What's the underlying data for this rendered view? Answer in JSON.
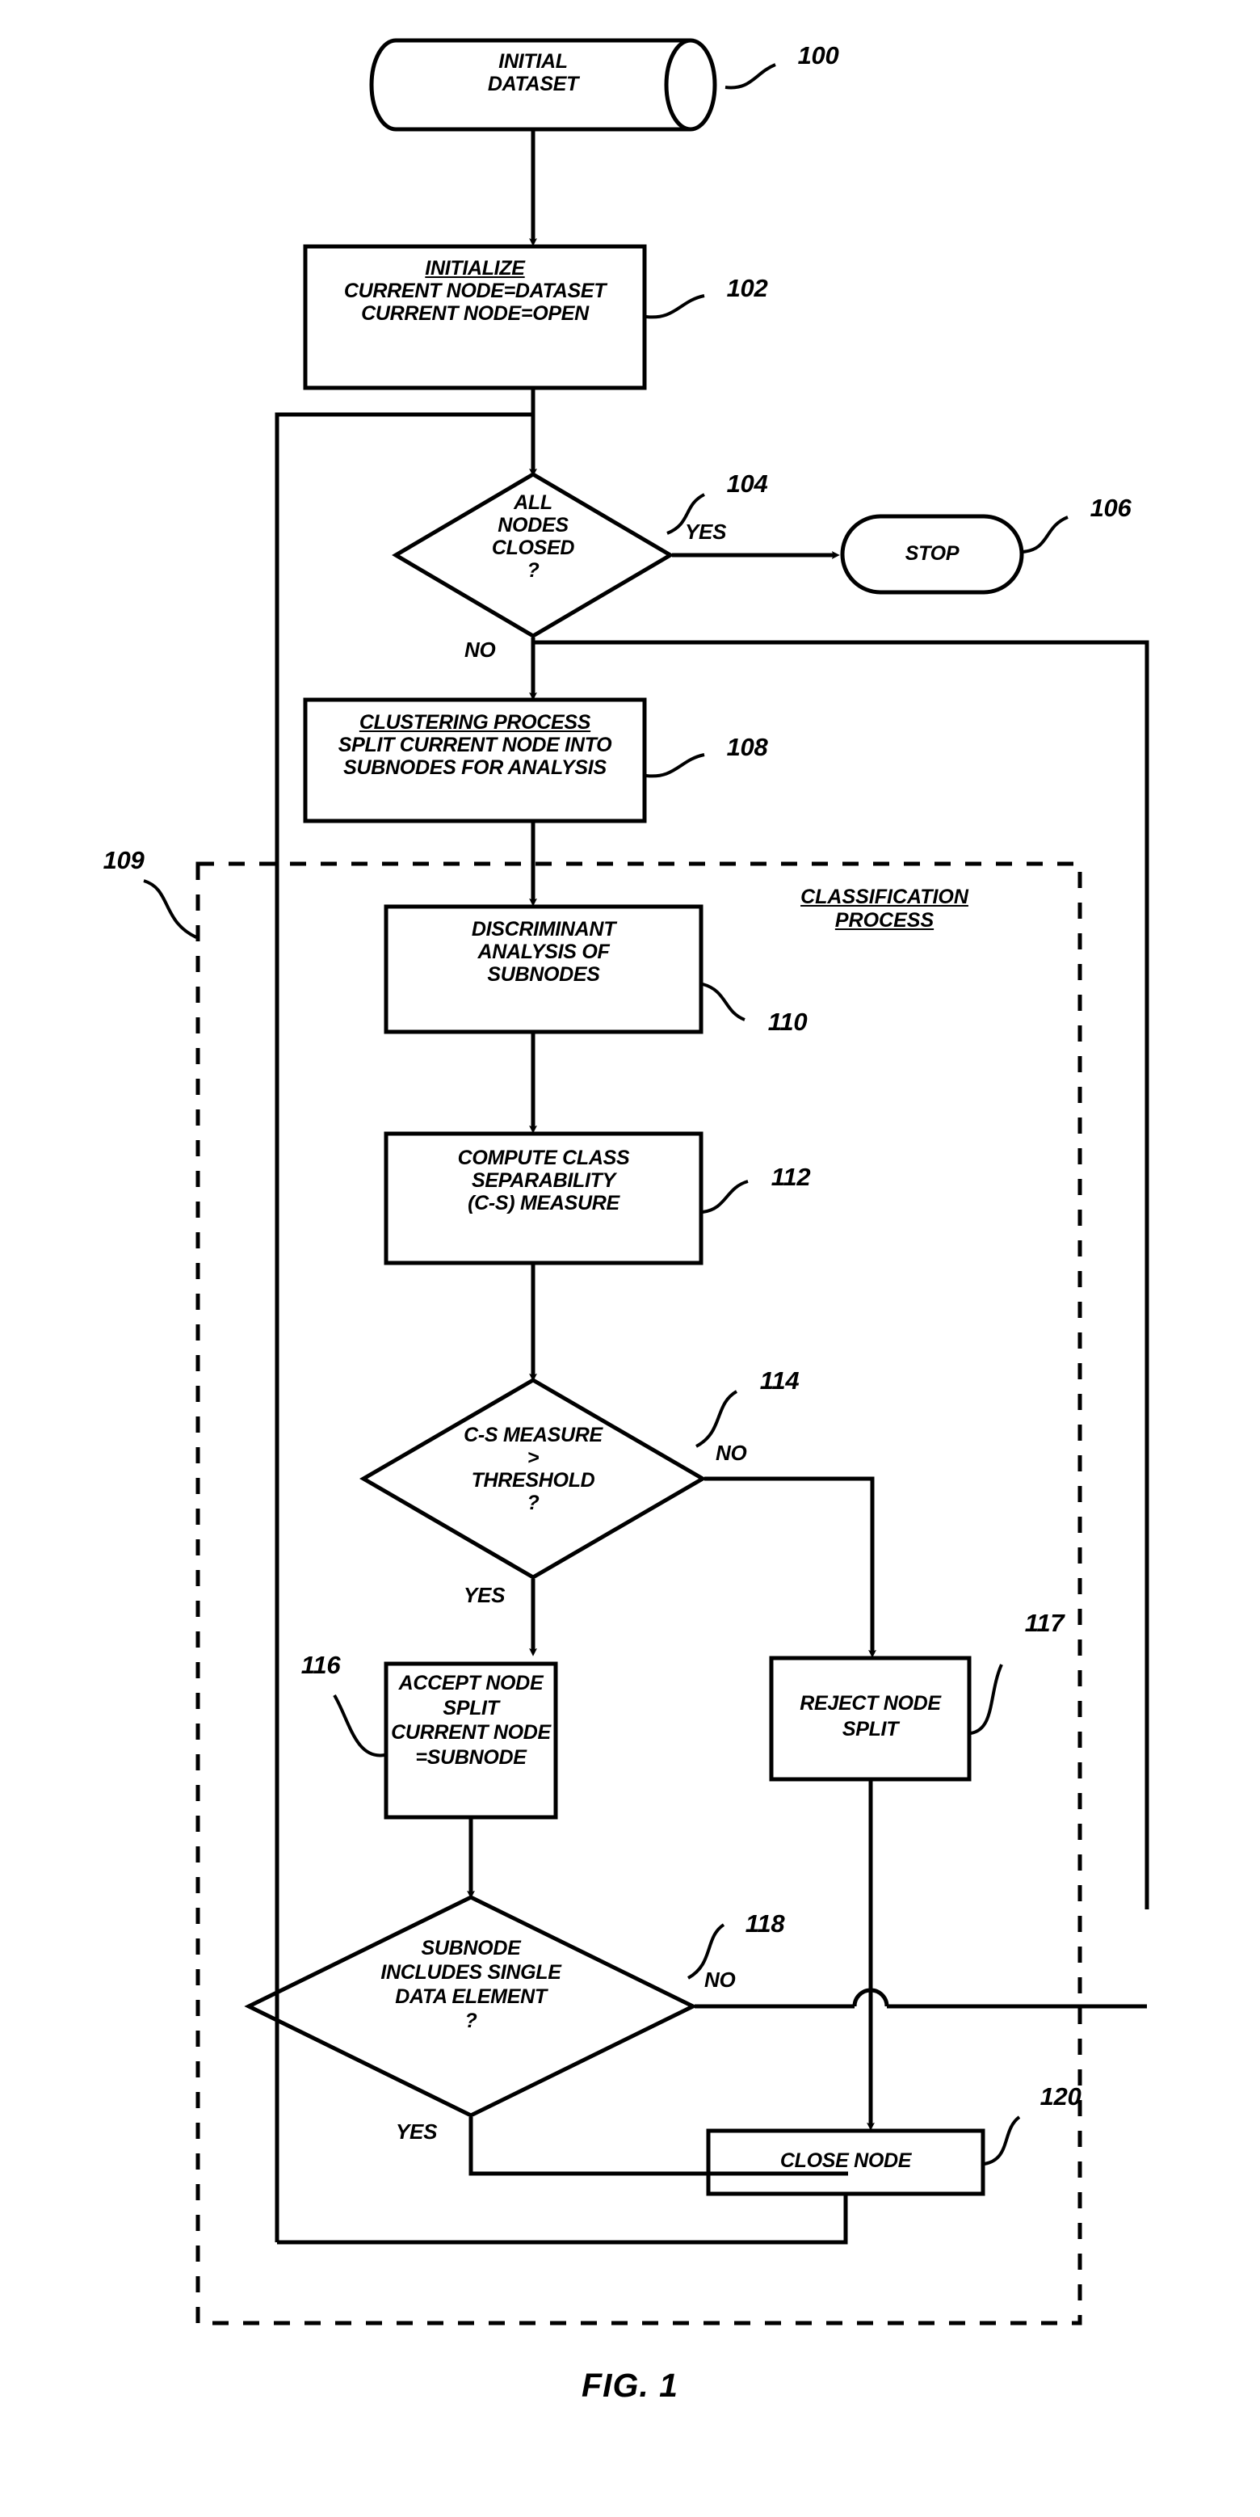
{
  "figure": {
    "caption": "FIG. 1",
    "title": "Flowchart of clustering and classification process"
  },
  "nodes": [
    {
      "id": "100",
      "ref": "100",
      "shape": "cylinder",
      "lines": [
        "INITIAL",
        "DATASET"
      ],
      "underline": []
    },
    {
      "id": "102",
      "ref": "102",
      "shape": "process",
      "lines": [
        "INITIALIZE",
        "CURRENT NODE=DATASET",
        "CURRENT NODE=OPEN"
      ],
      "underline": [
        0
      ]
    },
    {
      "id": "104",
      "ref": "104",
      "shape": "decision",
      "lines": [
        "ALL",
        "NODES",
        "CLOSED",
        "?"
      ],
      "underline": []
    },
    {
      "id": "106",
      "ref": "106",
      "shape": "terminator",
      "lines": [
        "STOP"
      ],
      "underline": []
    },
    {
      "id": "108",
      "ref": "108",
      "shape": "process",
      "lines": [
        "CLUSTERING PROCESS",
        "SPLIT CURRENT NODE INTO",
        "SUBNODES FOR ANALYSIS"
      ],
      "underline": [
        0
      ]
    },
    {
      "id": "110",
      "ref": "110",
      "shape": "process",
      "lines": [
        "DISCRIMINANT",
        "ANALYSIS OF",
        "SUBNODES"
      ],
      "underline": []
    },
    {
      "id": "112",
      "ref": "112",
      "shape": "process",
      "lines": [
        "COMPUTE CLASS",
        "SEPARABILITY",
        "(C-S) MEASURE"
      ],
      "underline": []
    },
    {
      "id": "114",
      "ref": "114",
      "shape": "decision",
      "lines": [
        "C-S MEASURE",
        ">",
        "THRESHOLD",
        "?"
      ],
      "underline": []
    },
    {
      "id": "116",
      "ref": "116",
      "shape": "process",
      "lines": [
        "ACCEPT NODE",
        "SPLIT",
        "CURRENT NODE",
        "=SUBNODE"
      ],
      "underline": []
    },
    {
      "id": "117",
      "ref": "117",
      "shape": "process",
      "lines": [
        "REJECT NODE",
        "SPLIT"
      ],
      "underline": []
    },
    {
      "id": "118",
      "ref": "118",
      "shape": "decision",
      "lines": [
        "SUBNODE",
        "INCLUDES SINGLE",
        "DATA ELEMENT",
        "?"
      ],
      "underline": []
    },
    {
      "id": "120",
      "ref": "120",
      "shape": "process",
      "lines": [
        "CLOSE NODE"
      ],
      "underline": []
    }
  ],
  "groups": [
    {
      "id": "109",
      "ref": "109",
      "label_lines": [
        "CLASSIFICATION",
        "PROCESS"
      ],
      "style": "dashed"
    }
  ],
  "branch_labels": {
    "d104_yes": "YES",
    "d104_no": "NO",
    "d114_no": "NO",
    "d114_yes": "YES",
    "d118_no": "NO",
    "d118_yes": "YES"
  },
  "text": {
    "node_100_l0": "INITIAL",
    "node_100_l1": "DATASET",
    "node_102_l0": "INITIALIZE",
    "node_102_l1": "CURRENT NODE=DATASET",
    "node_102_l2": "CURRENT NODE=OPEN",
    "node_104_l0": "ALL",
    "node_104_l1": "NODES",
    "node_104_l2": "CLOSED",
    "node_104_l3": "?",
    "node_106_l0": "STOP",
    "node_108_l0": "CLUSTERING PROCESS",
    "node_108_l1": "SPLIT CURRENT NODE INTO",
    "node_108_l2": "SUBNODES FOR ANALYSIS",
    "node_110_l0": "DISCRIMINANT",
    "node_110_l1": "ANALYSIS OF",
    "node_110_l2": "SUBNODES",
    "node_112_l0": "COMPUTE CLASS",
    "node_112_l1": "SEPARABILITY",
    "node_112_l2": "(C-S) MEASURE",
    "node_114_l0": "C-S MEASURE",
    "node_114_l1": ">",
    "node_114_l2": "THRESHOLD",
    "node_114_l3": "?",
    "node_116_l0": "ACCEPT NODE",
    "node_116_l1": "SPLIT",
    "node_116_l2": "CURRENT NODE",
    "node_116_l3": "=SUBNODE",
    "node_117_l0": "REJECT NODE",
    "node_117_l1": "SPLIT",
    "node_118_l0": "SUBNODE",
    "node_118_l1": "INCLUDES SINGLE",
    "node_118_l2": "DATA ELEMENT",
    "node_118_l3": "?",
    "node_120_l0": "CLOSE NODE",
    "group_109_l0": "CLASSIFICATION",
    "group_109_l1": "PROCESS"
  },
  "refs": {
    "r100": "100",
    "r102": "102",
    "r104": "104",
    "r106": "106",
    "r108": "108",
    "r109": "109",
    "r110": "110",
    "r112": "112",
    "r114": "114",
    "r116": "116",
    "r117": "117",
    "r118": "118",
    "r120": "120"
  },
  "colors": {
    "stroke": "#000000",
    "background": "#ffffff"
  }
}
